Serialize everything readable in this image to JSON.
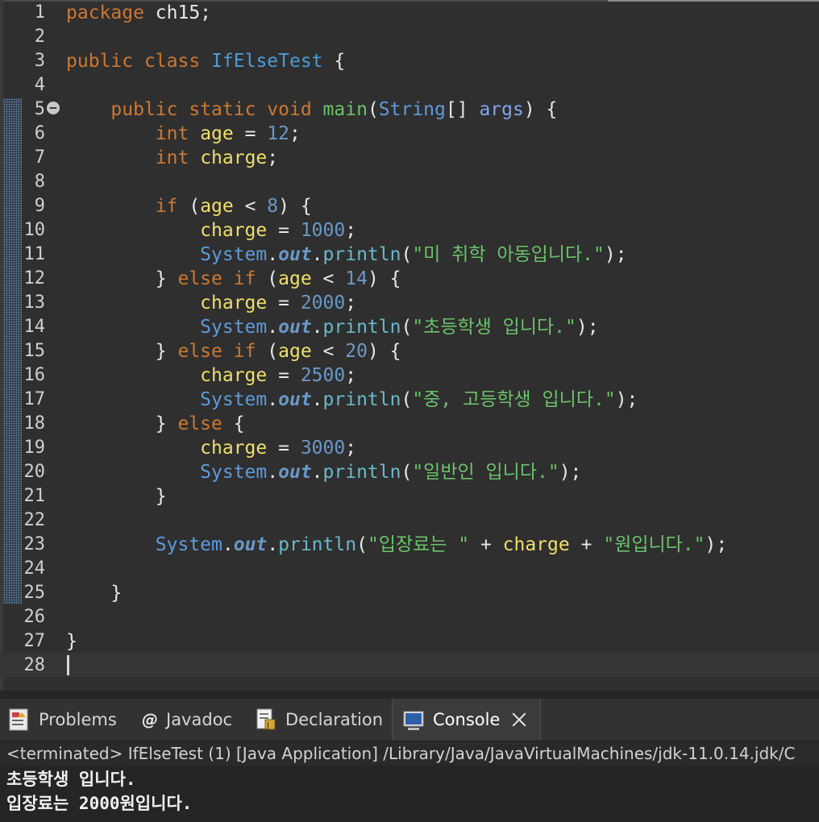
{
  "editor": {
    "line_numbers": [
      "1",
      "2",
      "3",
      "4",
      "5",
      "6",
      "7",
      "8",
      "9",
      "10",
      "11",
      "12",
      "13",
      "14",
      "15",
      "16",
      "17",
      "18",
      "19",
      "20",
      "21",
      "22",
      "23",
      "24",
      "25",
      "26",
      "27",
      "28"
    ],
    "lines": [
      [
        {
          "t": "package",
          "c": "kw"
        },
        {
          "t": " ch15;",
          "c": "pkg"
        }
      ],
      [],
      [
        {
          "t": "public",
          "c": "kw"
        },
        {
          "t": " ",
          "c": "fn"
        },
        {
          "t": "class",
          "c": "kw"
        },
        {
          "t": " ",
          "c": "fn"
        },
        {
          "t": "IfElseTest",
          "c": "cls"
        },
        {
          "t": " {",
          "c": "fn"
        }
      ],
      [],
      [
        {
          "t": "    "
        },
        {
          "t": "public",
          "c": "kw"
        },
        {
          "t": " "
        },
        {
          "t": "static",
          "c": "kw"
        },
        {
          "t": " "
        },
        {
          "t": "void",
          "c": "kw"
        },
        {
          "t": " "
        },
        {
          "t": "main",
          "c": "str"
        },
        {
          "t": "("
        },
        {
          "t": "String",
          "c": "typ"
        },
        {
          "t": "[] "
        },
        {
          "t": "args",
          "c": "par"
        },
        {
          "t": ") {"
        }
      ],
      [
        {
          "t": "        "
        },
        {
          "t": "int",
          "c": "kw"
        },
        {
          "t": " "
        },
        {
          "t": "age",
          "c": "var"
        },
        {
          "t": " = "
        },
        {
          "t": "12",
          "c": "num"
        },
        {
          "t": ";"
        }
      ],
      [
        {
          "t": "        "
        },
        {
          "t": "int",
          "c": "kw"
        },
        {
          "t": " "
        },
        {
          "t": "charge",
          "c": "var"
        },
        {
          "t": ";"
        }
      ],
      [],
      [
        {
          "t": "        "
        },
        {
          "t": "if",
          "c": "kw"
        },
        {
          "t": " ("
        },
        {
          "t": "age",
          "c": "var"
        },
        {
          "t": " < "
        },
        {
          "t": "8",
          "c": "num"
        },
        {
          "t": ") {"
        }
      ],
      [
        {
          "t": "            "
        },
        {
          "t": "charge",
          "c": "var"
        },
        {
          "t": " = "
        },
        {
          "t": "1000",
          "c": "num"
        },
        {
          "t": ";"
        }
      ],
      [
        {
          "t": "            "
        },
        {
          "t": "System",
          "c": "typ"
        },
        {
          "t": "."
        },
        {
          "t": "out",
          "c": "fld"
        },
        {
          "t": "."
        },
        {
          "t": "println",
          "c": "mth"
        },
        {
          "t": "("
        },
        {
          "t": "\"미 취학 아동입니다.\"",
          "c": "str"
        },
        {
          "t": ");"
        }
      ],
      [
        {
          "t": "        } "
        },
        {
          "t": "else",
          "c": "kw"
        },
        {
          "t": " "
        },
        {
          "t": "if",
          "c": "kw"
        },
        {
          "t": " ("
        },
        {
          "t": "age",
          "c": "var"
        },
        {
          "t": " < "
        },
        {
          "t": "14",
          "c": "num"
        },
        {
          "t": ") {"
        }
      ],
      [
        {
          "t": "            "
        },
        {
          "t": "charge",
          "c": "var"
        },
        {
          "t": " = "
        },
        {
          "t": "2000",
          "c": "num"
        },
        {
          "t": ";"
        }
      ],
      [
        {
          "t": "            "
        },
        {
          "t": "System",
          "c": "typ"
        },
        {
          "t": "."
        },
        {
          "t": "out",
          "c": "fld"
        },
        {
          "t": "."
        },
        {
          "t": "println",
          "c": "mth"
        },
        {
          "t": "("
        },
        {
          "t": "\"초등학생 입니다.\"",
          "c": "str"
        },
        {
          "t": ");"
        }
      ],
      [
        {
          "t": "        } "
        },
        {
          "t": "else",
          "c": "kw"
        },
        {
          "t": " "
        },
        {
          "t": "if",
          "c": "kw"
        },
        {
          "t": " ("
        },
        {
          "t": "age",
          "c": "var"
        },
        {
          "t": " < "
        },
        {
          "t": "20",
          "c": "num"
        },
        {
          "t": ") {"
        }
      ],
      [
        {
          "t": "            "
        },
        {
          "t": "charge",
          "c": "var"
        },
        {
          "t": " = "
        },
        {
          "t": "2500",
          "c": "num"
        },
        {
          "t": ";"
        }
      ],
      [
        {
          "t": "            "
        },
        {
          "t": "System",
          "c": "typ"
        },
        {
          "t": "."
        },
        {
          "t": "out",
          "c": "fld"
        },
        {
          "t": "."
        },
        {
          "t": "println",
          "c": "mth"
        },
        {
          "t": "("
        },
        {
          "t": "\"중, 고등학생 입니다.\"",
          "c": "str"
        },
        {
          "t": ");"
        }
      ],
      [
        {
          "t": "        } "
        },
        {
          "t": "else",
          "c": "kw"
        },
        {
          "t": " {"
        }
      ],
      [
        {
          "t": "            "
        },
        {
          "t": "charge",
          "c": "var"
        },
        {
          "t": " = "
        },
        {
          "t": "3000",
          "c": "num"
        },
        {
          "t": ";"
        }
      ],
      [
        {
          "t": "            "
        },
        {
          "t": "System",
          "c": "typ"
        },
        {
          "t": "."
        },
        {
          "t": "out",
          "c": "fld"
        },
        {
          "t": "."
        },
        {
          "t": "println",
          "c": "mth"
        },
        {
          "t": "("
        },
        {
          "t": "\"일반인 입니다.\"",
          "c": "str"
        },
        {
          "t": ");"
        }
      ],
      [
        {
          "t": "        }"
        }
      ],
      [],
      [
        {
          "t": "        "
        },
        {
          "t": "System",
          "c": "typ"
        },
        {
          "t": "."
        },
        {
          "t": "out",
          "c": "fld"
        },
        {
          "t": "."
        },
        {
          "t": "println",
          "c": "mth"
        },
        {
          "t": "("
        },
        {
          "t": "\"입장료는 \"",
          "c": "str"
        },
        {
          "t": " + "
        },
        {
          "t": "charge",
          "c": "var"
        },
        {
          "t": " + "
        },
        {
          "t": "\"원입니다.\"",
          "c": "str"
        },
        {
          "t": ");"
        }
      ],
      [],
      [
        {
          "t": "    }"
        }
      ],
      [],
      [
        {
          "t": "}"
        }
      ],
      []
    ]
  },
  "tabs": [
    {
      "label": "Problems",
      "icon": "problems-icon"
    },
    {
      "label": "Javadoc",
      "icon": "javadoc-icon"
    },
    {
      "label": "Declaration",
      "icon": "declaration-icon"
    },
    {
      "label": "Console",
      "icon": "console-icon"
    }
  ],
  "console": {
    "header": "<terminated> IfElseTest (1) [Java Application] /Library/Java/JavaVirtualMachines/jdk-11.0.14.jdk/C",
    "output": [
      "초등학생 입니다.",
      "입장료는 2000원입니다."
    ]
  },
  "colors": {
    "keyword": "#cc7832",
    "string": "#6bc26b",
    "number": "#6b98c7",
    "variable": "#f0df6a",
    "type": "#5d9bdc"
  }
}
